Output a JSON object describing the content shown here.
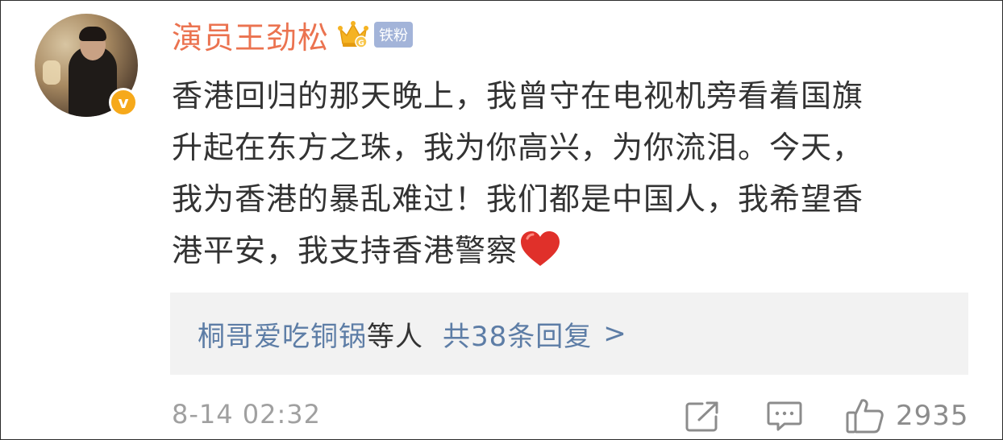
{
  "post": {
    "username": "演员王劲松",
    "badge": "铁粉",
    "verified_mark": "v",
    "text_lines": [
      "香港回归的那天晚上，我曾守在电视机旁看着国旗",
      "升起在东方之珠，我为你高兴，为你流泪。今天，",
      "我为香港的暴乱难过！我们都是中国人，我希望香",
      "港平安，我支持香港警察"
    ]
  },
  "replies": {
    "user": "桐哥爱吃铜锅",
    "suffix": "等人",
    "count_text": "共38条回复",
    "arrow": ">"
  },
  "footer": {
    "timestamp": "8-14 02:32",
    "like_count": "2935"
  },
  "icons": {
    "crown": "crown-icon",
    "heart": "heart-icon",
    "share": "share-icon",
    "comment": "comment-icon",
    "like": "like-icon"
  },
  "colors": {
    "username": "#eb7350",
    "link": "#5d7da6",
    "badge_bg": "#a3b4d9",
    "verified": "#f6a91b",
    "heart": "#e0302a"
  }
}
